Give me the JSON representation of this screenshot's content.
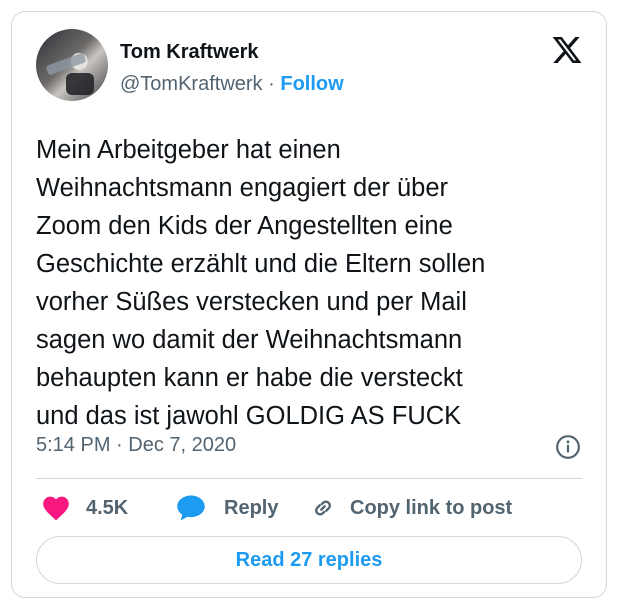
{
  "author": {
    "name": "Tom Kraftwerk",
    "handle": "@TomKraftwerk",
    "separator": "·",
    "follow_label": "Follow"
  },
  "tweet": {
    "lines": [
      "Mein Arbeitgeber hat einen",
      "Weihnachtsmann engagiert der über",
      "Zoom den Kids der Angestellten eine",
      "Geschichte erzählt und die Eltern sollen",
      "vorher Süßes verstecken und per Mail",
      "sagen wo damit der Weihnachtsmann",
      "behaupten kann er habe die versteckt",
      "und das ist jawohl GOLDIG AS FUCK"
    ],
    "timestamp": "5:14 PM · Dec 7, 2020"
  },
  "actions": {
    "like_count": "4.5K",
    "reply_label": "Reply",
    "copy_label": "Copy link to post"
  },
  "read_replies_label": "Read 27 replies",
  "icons": {
    "logo": "x-logo-icon",
    "like": "heart-icon",
    "reply": "reply-bubble-icon",
    "copy": "link-icon",
    "info": "info-icon"
  },
  "colors": {
    "accent": "#1d9bf0",
    "like": "#f91880",
    "secondary_text": "#536471",
    "border": "#cfd9de"
  }
}
